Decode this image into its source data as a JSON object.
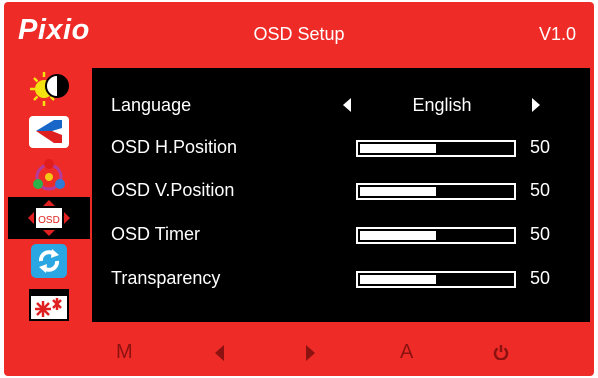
{
  "header": {
    "logo": "Pixio",
    "title": "OSD Setup",
    "version": "V1.0"
  },
  "sidebar": {
    "items": [
      {
        "icon": "brightness-contrast-icon"
      },
      {
        "icon": "picture-icon"
      },
      {
        "icon": "color-icon"
      },
      {
        "icon": "osd-icon",
        "label": "OSD",
        "active": true
      },
      {
        "icon": "reset-icon"
      },
      {
        "icon": "misc-settings-icon"
      }
    ]
  },
  "osd_settings": {
    "language": {
      "label": "Language",
      "value": "English"
    },
    "h_position": {
      "label": "OSD H.Position",
      "value": "50",
      "level_percent": 50
    },
    "v_position": {
      "label": "OSD V.Position",
      "value": "50",
      "level_percent": 50
    },
    "timer": {
      "label": "OSD Timer",
      "value": "50",
      "level_percent": 50
    },
    "transparency": {
      "label": "Transparency",
      "value": "50",
      "level_percent": 50
    }
  },
  "footer": {
    "menu_label": "M",
    "auto_label": "A",
    "buttons": [
      "menu-button",
      "left-button",
      "right-button",
      "auto-button",
      "power-button"
    ]
  },
  "colors": {
    "frame": "#ee2b27",
    "panel": "#000000",
    "text": "#ffffff",
    "footer_glyph": "#8b1210"
  }
}
